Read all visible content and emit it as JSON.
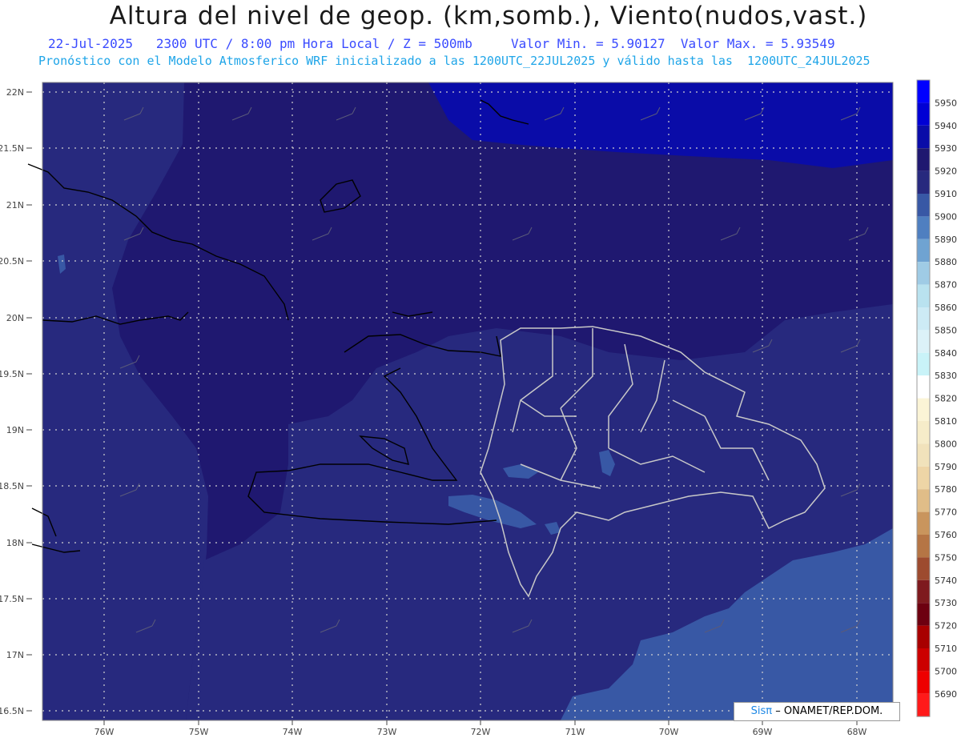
{
  "title": "Altura del nivel de geop. (km,somb.), Viento(nudos,vast.)",
  "subtitle": {
    "date": "22-Jul-2025",
    "time": "2300 UTC / 8:00 pm Hora Local / Z = 500mb",
    "min": "Valor Min. = 5.90127",
    "max": "Valor Max. = 5.93549"
  },
  "model_info": "Pronóstico con el Modelo Atmosferico WRF inicializado a las 1200UTC_22JUL2025 y válido hasta las  1200UTC_24JUL2025",
  "credit": {
    "brand": "Sisπ",
    "org": "– ONAMET/REP.DOM."
  },
  "axes": {
    "lat_labels": [
      "22N",
      "21.5N",
      "21N",
      "20.5N",
      "20N",
      "19.5N",
      "19N",
      "18.5N",
      "18N",
      "17.5N",
      "17N",
      "16.5N"
    ],
    "lon_labels": [
      "76W",
      "75W",
      "74W",
      "73W",
      "72W",
      "71W",
      "70W",
      "69W",
      "68W"
    ]
  },
  "legend": {
    "levels": [
      {
        "label": "5950",
        "color": "#0000ff"
      },
      {
        "label": "5940",
        "color": "#0000d4"
      },
      {
        "label": "5930",
        "color": "#0a0ca8"
      },
      {
        "label": "5920",
        "color": "#1f1870"
      },
      {
        "label": "5910",
        "color": "#27297e"
      },
      {
        "label": "5900",
        "color": "#3858a5"
      },
      {
        "label": "5890",
        "color": "#4f7fc0"
      },
      {
        "label": "5880",
        "color": "#6fa3d2"
      },
      {
        "label": "5870",
        "color": "#9fcbe5"
      },
      {
        "label": "5860",
        "color": "#b9e2ef"
      },
      {
        "label": "5850",
        "color": "#cdebf5"
      },
      {
        "label": "5840",
        "color": "#dcf2f8"
      },
      {
        "label": "5830",
        "color": "#c9f3f8"
      },
      {
        "label": "5820",
        "color": "#ffffff"
      },
      {
        "label": "5810",
        "color": "#fbf4d6"
      },
      {
        "label": "5800",
        "color": "#f6ecc9"
      },
      {
        "label": "5790",
        "color": "#f1e2bb"
      },
      {
        "label": "5780",
        "color": "#eed5a6"
      },
      {
        "label": "5770",
        "color": "#e0bd88"
      },
      {
        "label": "5760",
        "color": "#c9955d"
      },
      {
        "label": "5750",
        "color": "#b57545"
      },
      {
        "label": "5740",
        "color": "#9d4b2f"
      },
      {
        "label": "5730",
        "color": "#7e1a1e"
      },
      {
        "label": "5720",
        "color": "#6d0010"
      },
      {
        "label": "5710",
        "color": "#a80000"
      },
      {
        "label": "5700",
        "color": "#cc0000"
      },
      {
        "label": "5690",
        "color": "#ee0000"
      },
      {
        "label": "",
        "color": "#ff1a1a"
      }
    ]
  },
  "colors": {
    "field_5920": "#1f1870",
    "field_5910": "#27297e",
    "field_5930": "#0a0ca8",
    "field_5900": "#3858a5",
    "field_5890": "#4f7fc0",
    "coast": "#000000",
    "provinces": "#c8c8c8",
    "grid": "#d0d0d0"
  }
}
